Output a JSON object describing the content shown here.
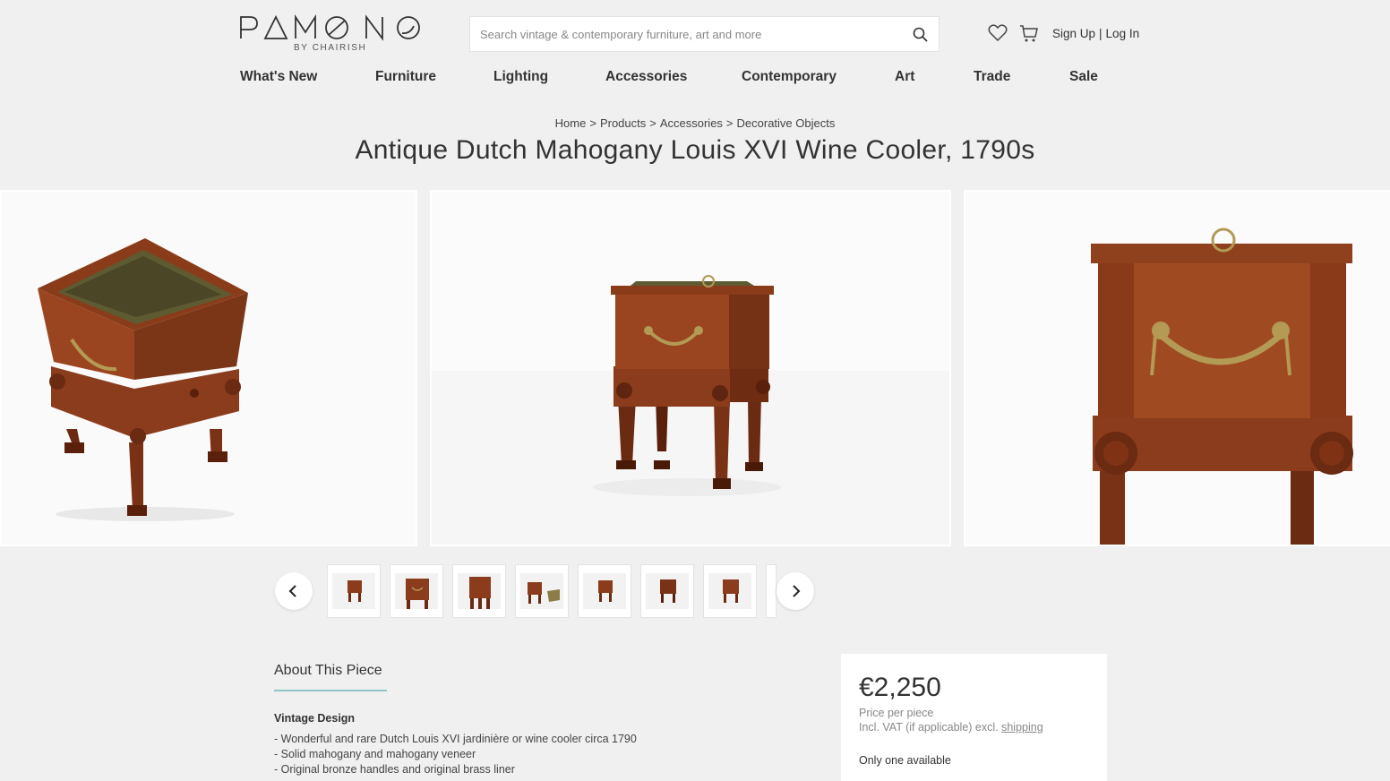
{
  "brand": {
    "name": "PAMONO",
    "sub": "BY CHAIRISH"
  },
  "search": {
    "placeholder": "Search vintage & contemporary furniture, art and more",
    "icon": "search-icon"
  },
  "header": {
    "sign_up": "Sign Up",
    "separator": "|",
    "log_in": "Log In",
    "wishlist_icon": "heart-icon",
    "cart_icon": "cart-icon"
  },
  "nav": [
    "What's New",
    "Furniture",
    "Lighting",
    "Accessories",
    "Contemporary",
    "Art",
    "Trade",
    "Sale"
  ],
  "breadcrumb": [
    "Home",
    "Products",
    "Accessories",
    "Decorative Objects"
  ],
  "breadcrumb_separator": ">",
  "product": {
    "title": "Antique Dutch Mahogany Louis XVI Wine Cooler, 1790s"
  },
  "gallery": {
    "prev_icon": "chevron-left-icon",
    "next_icon": "chevron-right-icon",
    "thumbnail_count": 7
  },
  "about": {
    "tab_label": "About This Piece",
    "section_heading": "Vintage Design",
    "lines": [
      "- Wonderful and rare Dutch Louis XVI jardinière or wine cooler circa 1790",
      "- Solid mahogany and mahogany veneer",
      "- Original bronze handles and original brass liner"
    ]
  },
  "pricing": {
    "price": "€2,250",
    "per": "Price per piece",
    "vat_prefix": "Incl. VAT (if applicable) excl.",
    "shipping_link": "shipping",
    "availability": "Only one available"
  },
  "colors": {
    "background": "#f0f0f0",
    "accent": "#8fc6c8",
    "wood": "#8b3c1c",
    "brass": "#b39a55"
  }
}
